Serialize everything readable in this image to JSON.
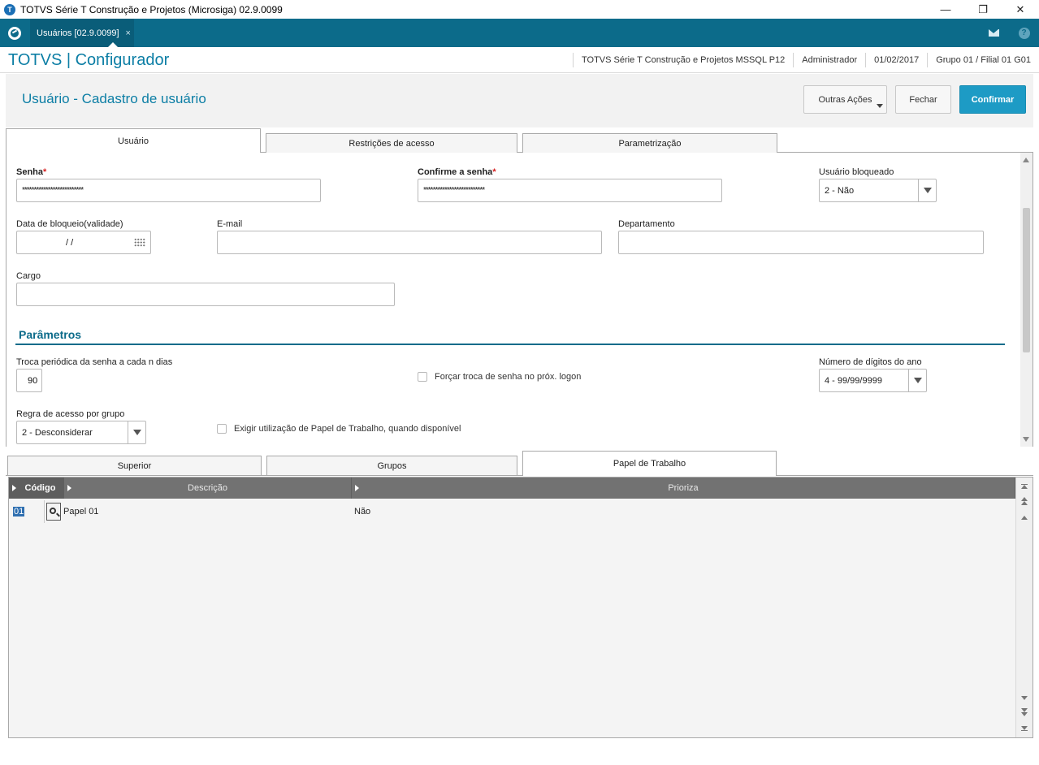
{
  "window": {
    "title": "TOTVS Série T Construção e Projetos (Microsiga) 02.9.0099",
    "controls": {
      "minimize": "—",
      "restore": "❐",
      "close": "✕"
    }
  },
  "app_tabs": {
    "active_tab": "Usuários [02.9.0099]",
    "close_glyph": "×"
  },
  "module": {
    "title": "TOTVS | Configurador",
    "info": [
      "TOTVS Série T Construção e Projetos MSSQL P12",
      "Administrador",
      "01/02/2017",
      "Grupo 01 / Filial 01 G01"
    ]
  },
  "page": {
    "title": "Usuário - Cadastro de usuário",
    "buttons": {
      "outras": "Outras Ações",
      "fechar": "Fechar",
      "confirmar": "Confirmar"
    }
  },
  "tabs": [
    "Usuário",
    "Restrições de acesso",
    "Parametrização"
  ],
  "form": {
    "senha": {
      "label": "Senha",
      "required": "*",
      "value": "**************************"
    },
    "confirme": {
      "label": "Confirme a senha",
      "required": "*",
      "value": "**************************"
    },
    "bloqueado": {
      "label": "Usuário bloqueado",
      "value": "2 - Não"
    },
    "data_bloqueio": {
      "label": "Data de bloqueio(validade)",
      "value": "/ /"
    },
    "email": {
      "label": "E-mail",
      "value": ""
    },
    "departamento": {
      "label": "Departamento",
      "value": ""
    },
    "cargo": {
      "label": "Cargo",
      "value": ""
    },
    "section_title": "Parâmetros",
    "troca": {
      "label": "Troca periódica da senha a cada n dias",
      "value": "90"
    },
    "forcar": {
      "label": "Forçar troca de senha no próx. logon",
      "checked": false
    },
    "digitos": {
      "label": "Número de dígitos do ano",
      "value": "4 - 99/99/9999"
    },
    "regra": {
      "label": "Regra de acesso por grupo",
      "value": "2 - Desconsiderar"
    },
    "exigir": {
      "label": "Exigir utilização de Papel de Trabalho, quando disponível",
      "checked": false
    }
  },
  "lower_tabs": [
    "Superior",
    "Grupos",
    "Papel de Trabalho"
  ],
  "grid": {
    "columns": [
      "Código",
      "Descrição",
      "Prioriza"
    ],
    "rows": [
      {
        "codigo": "01",
        "descricao": "Papel 01",
        "prioriza": "Não"
      }
    ]
  },
  "colors": {
    "primary": "#0c6b8a",
    "accent": "#1d9bc5",
    "title": "#0c7ea5"
  }
}
